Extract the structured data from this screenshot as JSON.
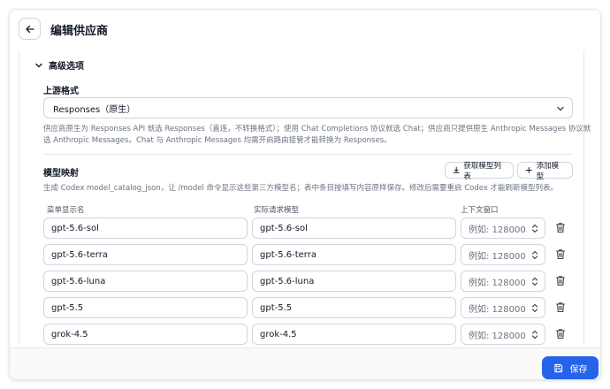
{
  "header": {
    "title": "编辑供应商"
  },
  "advanced": {
    "title": "高级选项"
  },
  "upstream": {
    "label": "上游格式",
    "selected": "Responses（原生）",
    "help_line1": "供应商原生为 Responses API 就选 Responses（直连，不转换格式）；使用 Chat Completions 协议就选 Chat；供应商只提供原生 Anthropic Messages 协议就",
    "help_line2": "选 Anthropic Messages。Chat 与 Anthropic Messages 均需开启路由接管才能转换为 Responses。"
  },
  "mapping": {
    "label": "模型映射",
    "fetch_label": "获取模型列表",
    "add_label": "添加模型",
    "help": "生成 Codex model_catalog_json，让 /model 命令显示这些第三方模型名；表中条目按填写内容原样保存。修改后需要重启 Codex 才能刷新模型列表。",
    "columns": [
      "菜单显示名",
      "实际请求模型",
      "上下文窗口"
    ],
    "ctx_placeholder": "例如: 128000",
    "rows": [
      {
        "name": "gpt-5.6-sol",
        "model": "gpt-5.6-sol"
      },
      {
        "name": "gpt-5.6-terra",
        "model": "gpt-5.6-terra"
      },
      {
        "name": "gpt-5.6-luna",
        "model": "gpt-5.6-luna"
      },
      {
        "name": "gpt-5.5",
        "model": "gpt-5.5"
      },
      {
        "name": "grok-4.5",
        "model": "grok-4.5"
      }
    ]
  },
  "footer": {
    "save_label": "保存"
  },
  "colors": {
    "accent": "#2563eb",
    "border": "#d1d5db",
    "muted": "#6b7280"
  }
}
